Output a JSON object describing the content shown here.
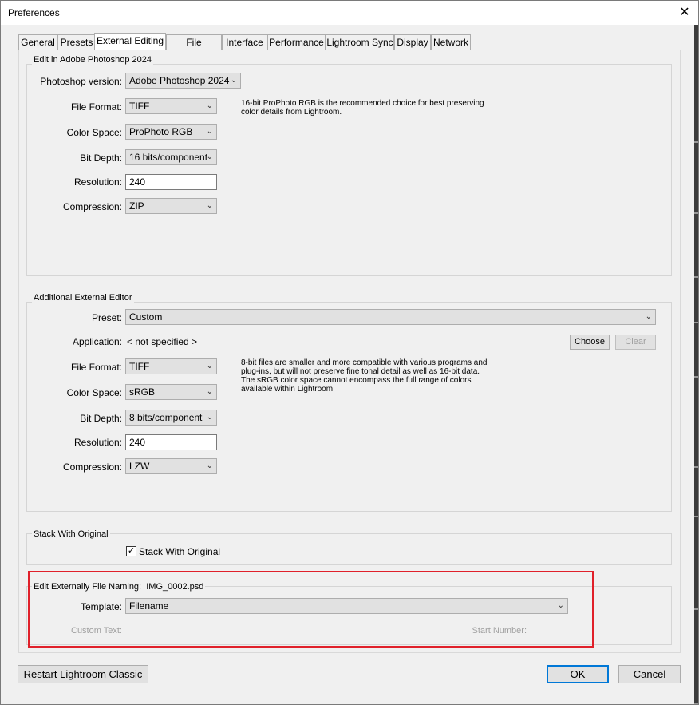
{
  "window": {
    "title": "Preferences",
    "close_glyph": "✕"
  },
  "tabs": [
    "General",
    "Presets",
    "External Editing",
    "File Handling",
    "Interface",
    "Performance",
    "Lightroom Sync",
    "Display",
    "Network"
  ],
  "photoshop": {
    "group_title": "Edit in Adobe Photoshop 2024",
    "version_label": "Photoshop version:",
    "version_value": "Adobe Photoshop 2024",
    "file_format_label": "File Format:",
    "file_format_value": "TIFF",
    "color_space_label": "Color Space:",
    "color_space_value": "ProPhoto RGB",
    "bit_depth_label": "Bit Depth:",
    "bit_depth_value": "16 bits/component",
    "resolution_label": "Resolution:",
    "resolution_value": "240",
    "compression_label": "Compression:",
    "compression_value": "ZIP",
    "note_line1": "16-bit ProPhoto RGB is the recommended choice for best preserving",
    "note_line2": "color details from Lightroom."
  },
  "additional": {
    "group_title": "Additional External Editor",
    "preset_label": "Preset:",
    "preset_value": "Custom",
    "application_label": "Application:",
    "application_value": "< not specified >",
    "choose_label": "Choose",
    "clear_label": "Clear",
    "file_format_label": "File Format:",
    "file_format_value": "TIFF",
    "color_space_label": "Color Space:",
    "color_space_value": "sRGB",
    "bit_depth_label": "Bit Depth:",
    "bit_depth_value": "8 bits/component",
    "resolution_label": "Resolution:",
    "resolution_value": "240",
    "compression_label": "Compression:",
    "compression_value": "LZW",
    "note_line1": "8-bit files are smaller and more compatible with various programs and",
    "note_line2": "plug-ins, but will not preserve fine tonal detail as well as 16-bit data.",
    "note_line3": "The sRGB color space cannot encompass the full range of colors",
    "note_line4": "available within Lightroom."
  },
  "stack": {
    "group_title": "Stack With Original",
    "checkbox_label": "Stack With Original",
    "checked": true
  },
  "naming": {
    "group_title": "Edit Externally File Naming:",
    "example": "IMG_0002.psd",
    "template_label": "Template:",
    "template_value": "Filename",
    "custom_text_label": "Custom Text:",
    "start_number_label": "Start Number:"
  },
  "footer": {
    "restart_label": "Restart Lightroom Classic",
    "ok_label": "OK",
    "cancel_label": "Cancel"
  },
  "colors": {
    "highlight_box": "#e0202a",
    "default_button_border": "#0078d7"
  }
}
